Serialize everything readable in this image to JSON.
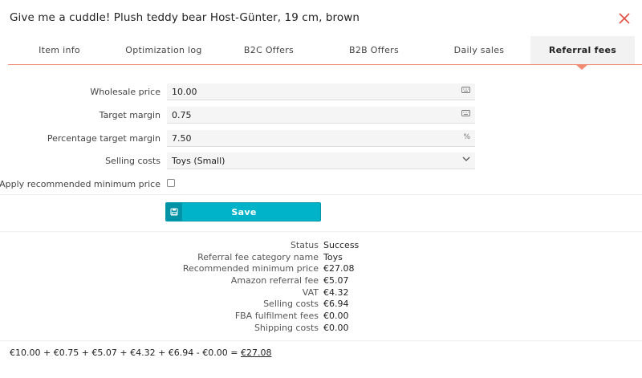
{
  "dialog": {
    "title": "Give me a cuddle! Plush teddy bear Host-Günter, 19 cm, brown"
  },
  "tabs": [
    {
      "label": "Item info",
      "active": false
    },
    {
      "label": "Optimization log",
      "active": false
    },
    {
      "label": "B2C Offers",
      "active": false
    },
    {
      "label": "B2B Offers",
      "active": false
    },
    {
      "label": "Daily sales",
      "active": false
    },
    {
      "label": "Referral fees",
      "active": true
    }
  ],
  "form": {
    "wholesale_price": {
      "label": "Wholesale price",
      "value": "10.00",
      "suffix_icon": "keyboard-icon"
    },
    "target_margin": {
      "label": "Target margin",
      "value": "0.75",
      "suffix_icon": "keyboard-icon"
    },
    "percentage_target_margin": {
      "label": "Percentage target margin",
      "value": "7.50",
      "suffix": "%"
    },
    "selling_costs": {
      "label": "Selling costs",
      "value": "Toys (Small)",
      "suffix_icon": "chevron-down-icon"
    },
    "apply_min_price": {
      "label": "Apply recommended minimum price",
      "checked": false
    }
  },
  "save_button": {
    "label": "Save",
    "icon": "floppy-disk-icon"
  },
  "results": [
    {
      "label": "Status",
      "value": "Success"
    },
    {
      "label": "Referral fee category name",
      "value": "Toys"
    },
    {
      "label": "Recommended minimum price",
      "value": "€27.08"
    },
    {
      "label": "Amazon referral fee",
      "value": "€5.07"
    },
    {
      "label": "VAT",
      "value": "€4.32"
    },
    {
      "label": "Selling costs",
      "value": "€6.94"
    },
    {
      "label": "FBA fulfilment fees",
      "value": "€0.00"
    },
    {
      "label": "Shipping costs",
      "value": "€0.00"
    }
  ],
  "formula": {
    "expression": "€10.00 + €0.75 + €5.07 + €4.32 + €6.94 - €0.00 = ",
    "total": "€27.08"
  },
  "colors": {
    "accent": "#f08a73",
    "close": "#e04e43",
    "button": "#00b3c9"
  }
}
